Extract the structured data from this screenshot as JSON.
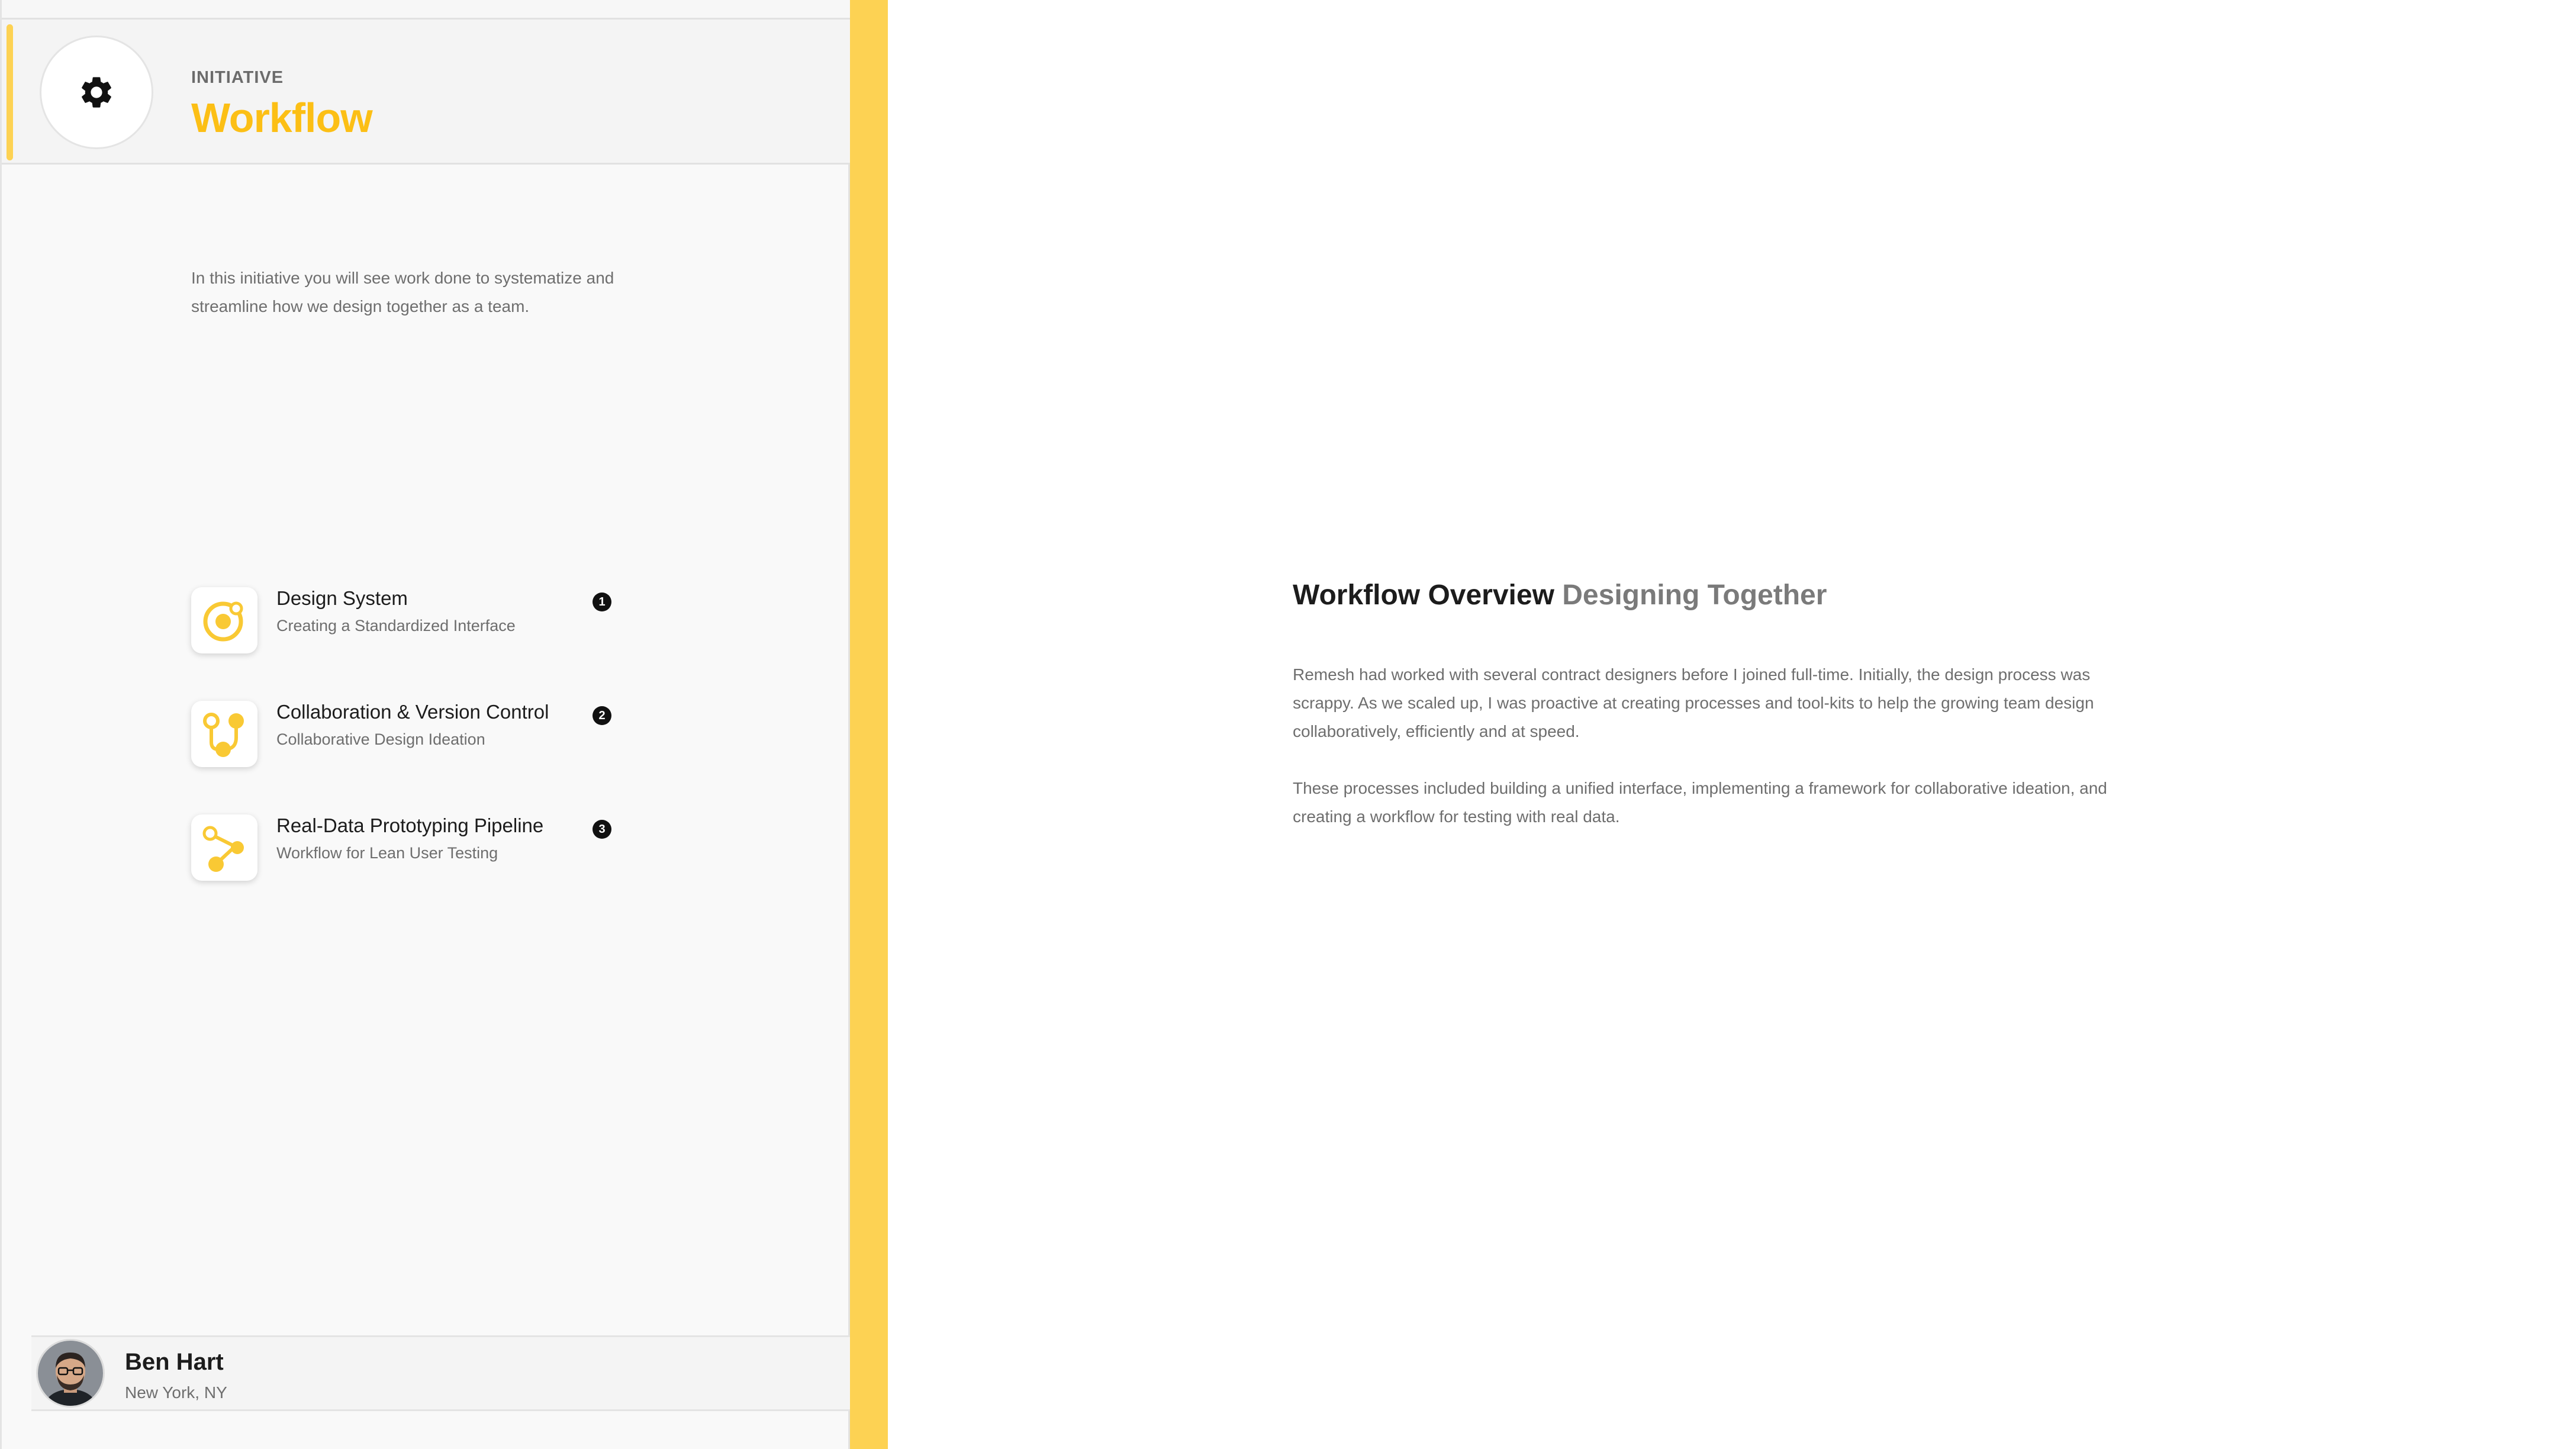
{
  "sidebar": {
    "header": {
      "eyebrow": "INITIATIVE",
      "title": "Workflow",
      "icon": "gear-icon"
    },
    "intro": "In this initiative you will see work done to systematize and streamline how we design together as a team.",
    "items": [
      {
        "title": "Design System",
        "subtitle": "Creating a Standardized Interface",
        "badge": "1",
        "icon": "target-icon"
      },
      {
        "title": "Collaboration & Version Control",
        "subtitle": "Collaborative Design Ideation",
        "badge": "2",
        "icon": "branch-icon"
      },
      {
        "title": "Real-Data Prototyping Pipeline",
        "subtitle": "Workflow for Lean User Testing",
        "badge": "3",
        "icon": "pipeline-icon"
      }
    ],
    "profile": {
      "name": "Ben Hart",
      "location": "New York, NY"
    }
  },
  "main": {
    "heading_primary": "Workflow Overview",
    "heading_secondary": "Designing Together",
    "paragraphs": [
      "Remesh had worked with several contract designers before I joined full-time. Initially, the design process was scrappy. As we scaled up, I was proactive at creating processes and tool-kits to help the growing team design collaboratively, efficiently and at speed.",
      "These processes included building a unified interface, implementing a framework for collaborative ideation, and creating a workflow for testing with real data."
    ]
  },
  "colors": {
    "accent": "#fdd253",
    "title_yellow": "#fcbf15",
    "icon_yellow": "#f9c934",
    "text_dark": "#1c1c1c",
    "text_muted": "#6e6e6e"
  }
}
